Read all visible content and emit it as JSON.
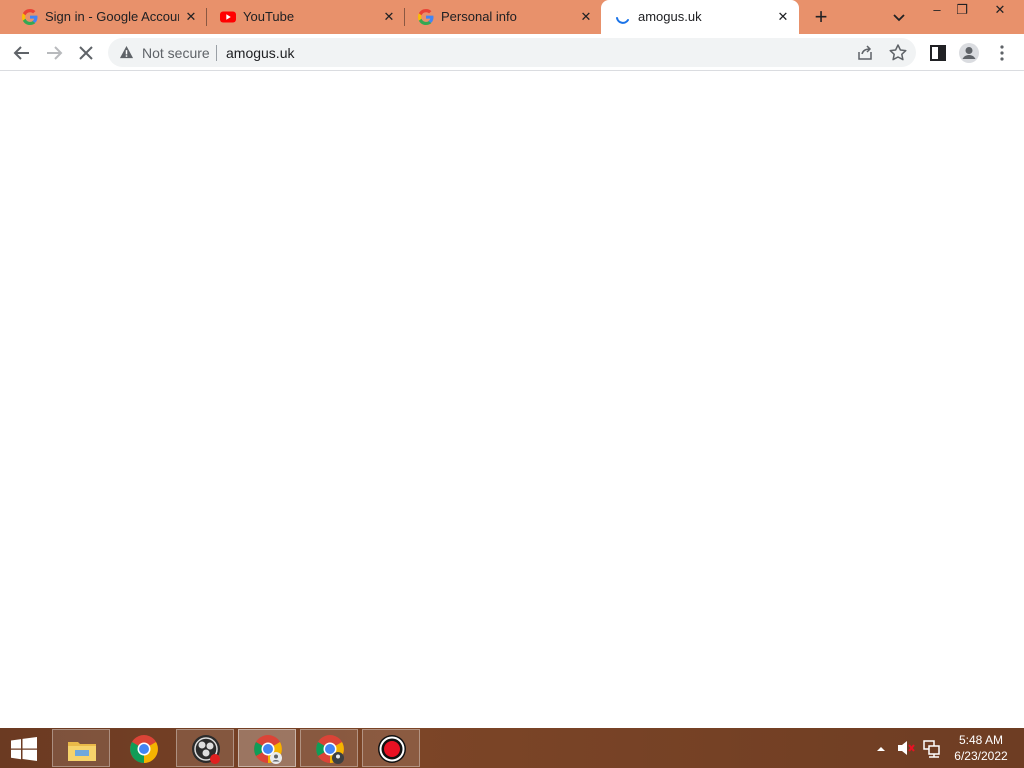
{
  "browser": {
    "tabs": [
      {
        "title": "Sign in - Google Accounts",
        "favicon": "google-g-icon",
        "active": false
      },
      {
        "title": "YouTube",
        "favicon": "youtube-icon",
        "active": false
      },
      {
        "title": "Personal info",
        "favicon": "google-g-icon",
        "active": false
      },
      {
        "title": "amogus.uk",
        "favicon": "loading-spinner-icon",
        "active": true
      }
    ],
    "new_tab": "+",
    "window_controls": {
      "minimize": "–",
      "restore": "❐",
      "close": "✕"
    }
  },
  "toolbar": {
    "security_label": "Not secure",
    "url": "amogus.uk"
  },
  "taskbar": {
    "apps": [
      {
        "name": "file-explorer",
        "state": "framed"
      },
      {
        "name": "chrome",
        "state": "normal"
      },
      {
        "name": "obs",
        "state": "framed"
      },
      {
        "name": "chrome-profile",
        "state": "active"
      },
      {
        "name": "chrome-guest",
        "state": "framed"
      },
      {
        "name": "screen-recorder",
        "state": "framed"
      }
    ],
    "clock": {
      "time": "5:48 AM",
      "date": "6/23/2022"
    }
  },
  "colors": {
    "tabstrip": "#e8916b",
    "taskbar": "#7c4527",
    "omnibox": "#f1f3f4"
  }
}
